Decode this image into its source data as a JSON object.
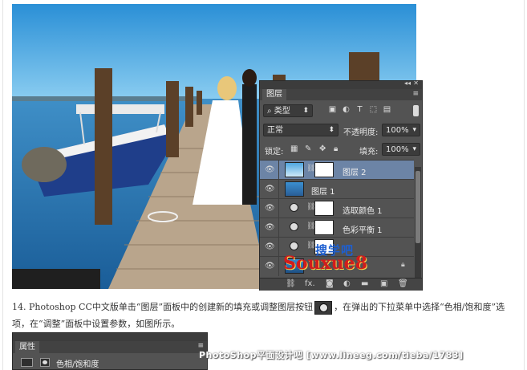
{
  "layers_panel": {
    "tab": "图层",
    "collapse_glyph": "◂◂",
    "close_glyph": "✕",
    "menu_glyph": "≡",
    "filter_kind": "类型",
    "filter_icons": [
      "image-filter-icon",
      "adjustment-filter-icon",
      "type-filter-icon",
      "shape-filter-icon",
      "smartobject-filter-icon"
    ],
    "blend_mode": "正常",
    "opacity_label": "不透明度:",
    "opacity_value": "100%",
    "lock_label": "锁定:",
    "fill_label": "填充:",
    "fill_value": "100%",
    "layers": [
      {
        "name": "图层 2",
        "type": "pixel+mask",
        "selected": true
      },
      {
        "name": "图层 1",
        "type": "pixel",
        "selected": false
      },
      {
        "name": "选取颜色 1",
        "type": "adjustment",
        "selected": false
      },
      {
        "name": "色彩平衡 1",
        "type": "adjustment",
        "selected": false
      },
      {
        "name": "",
        "type": "adjustment",
        "selected": false
      },
      {
        "name": "",
        "type": "background",
        "selected": false
      }
    ],
    "bottom_icons": [
      "link-icon",
      "fx-icon",
      "mask-icon",
      "adjustment-icon",
      "folder-icon",
      "new-layer-icon",
      "trash-icon"
    ],
    "fx_label": "fx."
  },
  "watermarks": {
    "site_cn": "搜学吧",
    "site_logo": "Souxue8",
    "footer": "PhotoShop平面设计吧 [www.lineeg.com/tieba/1783]"
  },
  "caption": {
    "part1": "14. Photoshop CC中文版单击“图层”面板中的创建新的填充或调整图层按钮",
    "part2": "，在弹出的下拉菜单中选择“色相/饱和度”选项，在“调整”面板中设置参数，如图所示。"
  },
  "properties_panel": {
    "tab": "属性",
    "menu_glyph": "≡",
    "title": "色相/饱和度"
  }
}
